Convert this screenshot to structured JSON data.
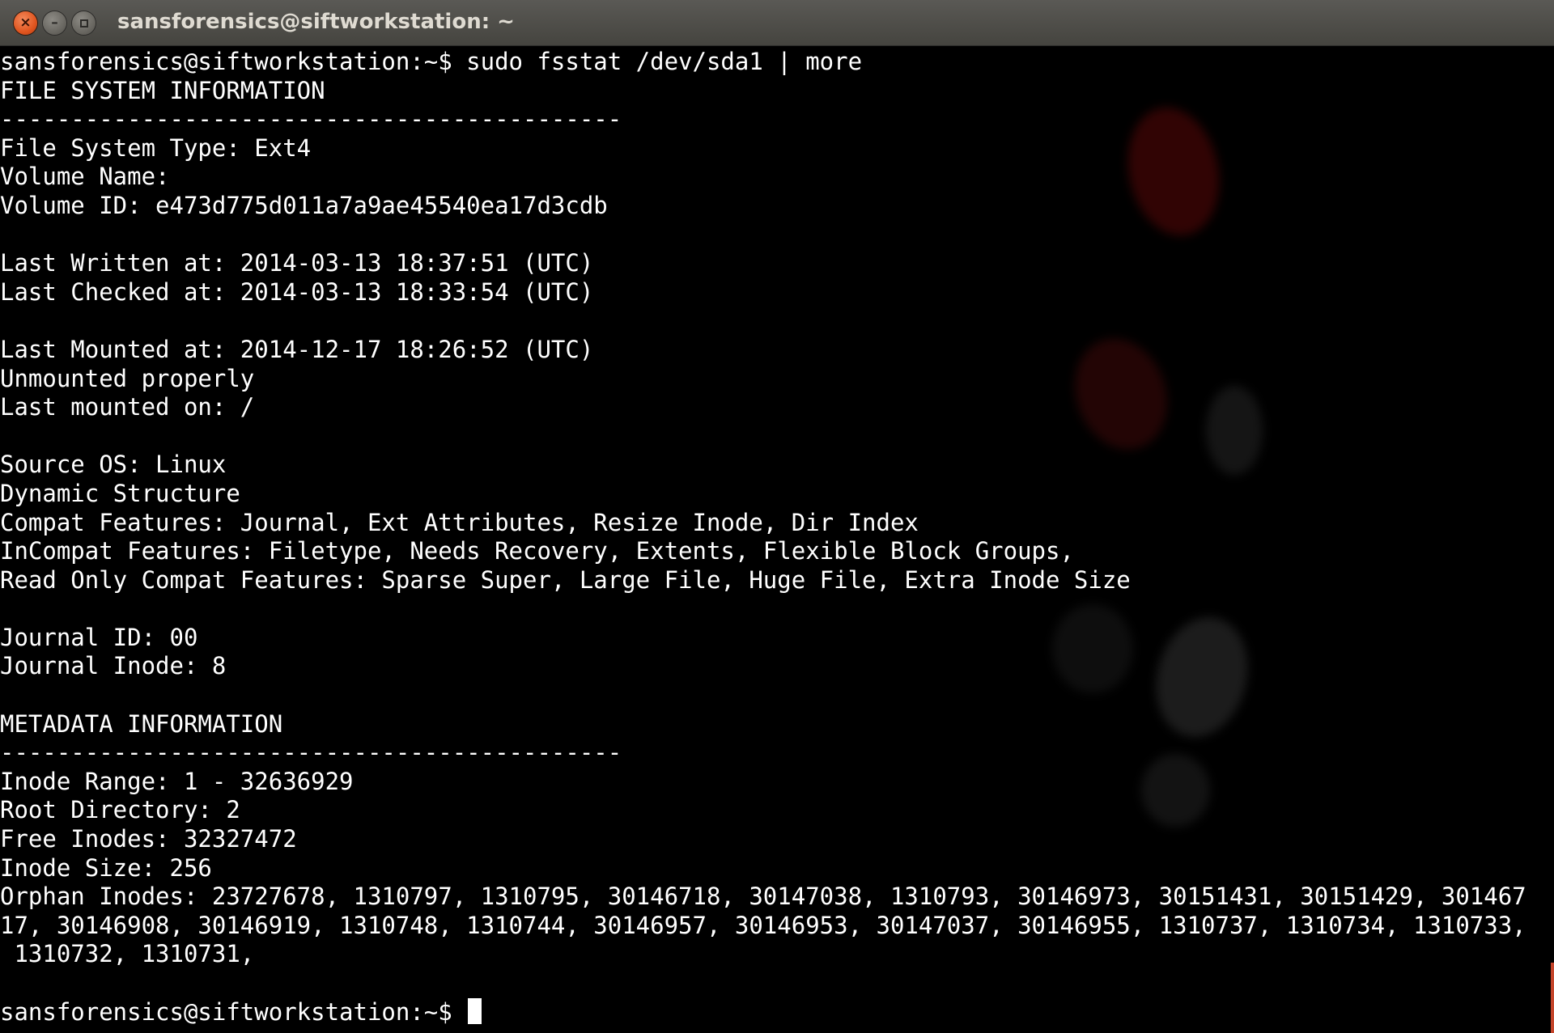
{
  "window": {
    "title": "sansforensics@siftworkstation: ~",
    "close_symbol": "×",
    "minimize_symbol": "–",
    "close_icon": "close-icon",
    "minimize_icon": "minimize-icon",
    "maximize_icon": "maximize-icon"
  },
  "terminal": {
    "lines": [
      "sansforensics@siftworkstation:~$ sudo fsstat /dev/sda1 | more",
      "FILE SYSTEM INFORMATION",
      "--------------------------------------------",
      "File System Type: Ext4",
      "Volume Name:",
      "Volume ID: e473d775d011a7a9ae45540ea17d3cdb",
      "",
      "Last Written at: 2014-03-13 18:37:51 (UTC)",
      "Last Checked at: 2014-03-13 18:33:54 (UTC)",
      "",
      "Last Mounted at: 2014-12-17 18:26:52 (UTC)",
      "Unmounted properly",
      "Last mounted on: /",
      "",
      "Source OS: Linux",
      "Dynamic Structure",
      "Compat Features: Journal, Ext Attributes, Resize Inode, Dir Index",
      "InCompat Features: Filetype, Needs Recovery, Extents, Flexible Block Groups,",
      "Read Only Compat Features: Sparse Super, Large File, Huge File, Extra Inode Size",
      "",
      "Journal ID: 00",
      "Journal Inode: 8",
      "",
      "METADATA INFORMATION",
      "--------------------------------------------",
      "Inode Range: 1 - 32636929",
      "Root Directory: 2",
      "Free Inodes: 32327472",
      "Inode Size: 256",
      "Orphan Inodes: 23727678, 1310797, 1310795, 30146718, 30147038, 1310793, 30146973, 30151431, 30151429, 301467",
      "17, 30146908, 30146919, 1310748, 1310744, 30146957, 30146953, 30147037, 30146955, 1310737, 1310734, 1310733,",
      " 1310732, 1310731,",
      ""
    ],
    "prompt": "sansforensics@siftworkstation:~$ "
  },
  "colors": {
    "background": "#000000",
    "text": "#ffffff",
    "titlebar": "#4d4c48",
    "close_button": "#e0551f"
  }
}
